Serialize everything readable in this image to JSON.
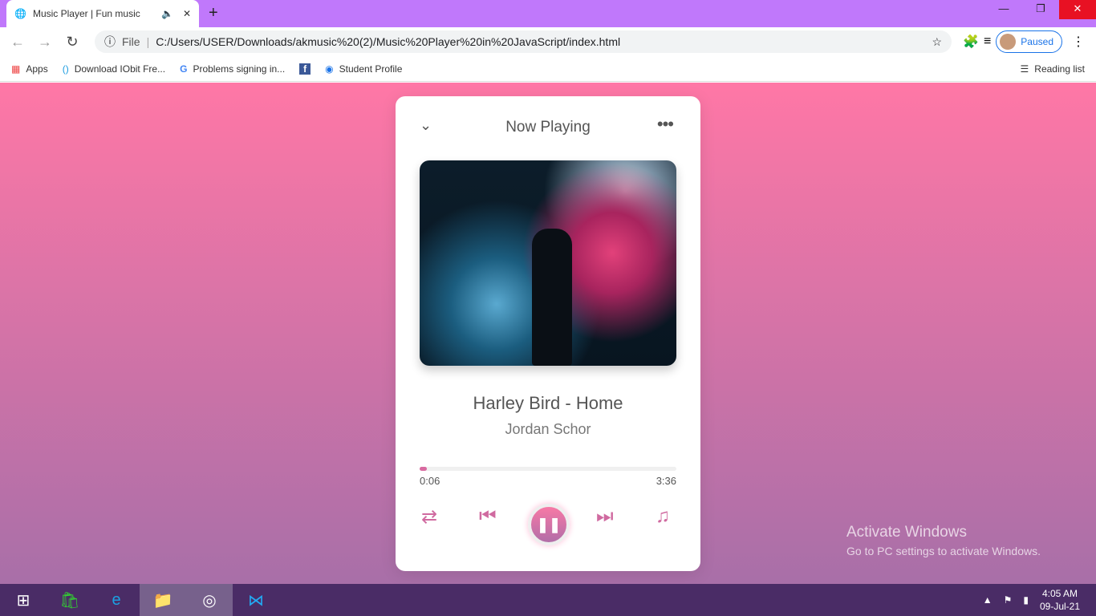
{
  "browser": {
    "tab_title": "Music Player | Fun music",
    "url_scheme": "File",
    "url": "C:/Users/USER/Downloads/akmusic%20(2)/Music%20Player%20in%20JavaScript/index.html",
    "profile_status": "Paused",
    "bookmarks": [
      "Apps",
      "Download IObit Fre...",
      "Problems signing in...",
      "",
      "Student Profile"
    ],
    "reading_list": "Reading list"
  },
  "player": {
    "header": "Now Playing",
    "song_title": "Harley Bird - Home",
    "artist": "Jordan Schor",
    "current_time": "0:06",
    "duration": "3:36",
    "progress_percent": 2.8,
    "accent": "#d86aa0"
  },
  "watermark": {
    "line1": "Activate Windows",
    "line2": "Go to PC settings to activate Windows."
  },
  "taskbar": {
    "time": "4:05 AM",
    "date": "09-Jul-21"
  }
}
